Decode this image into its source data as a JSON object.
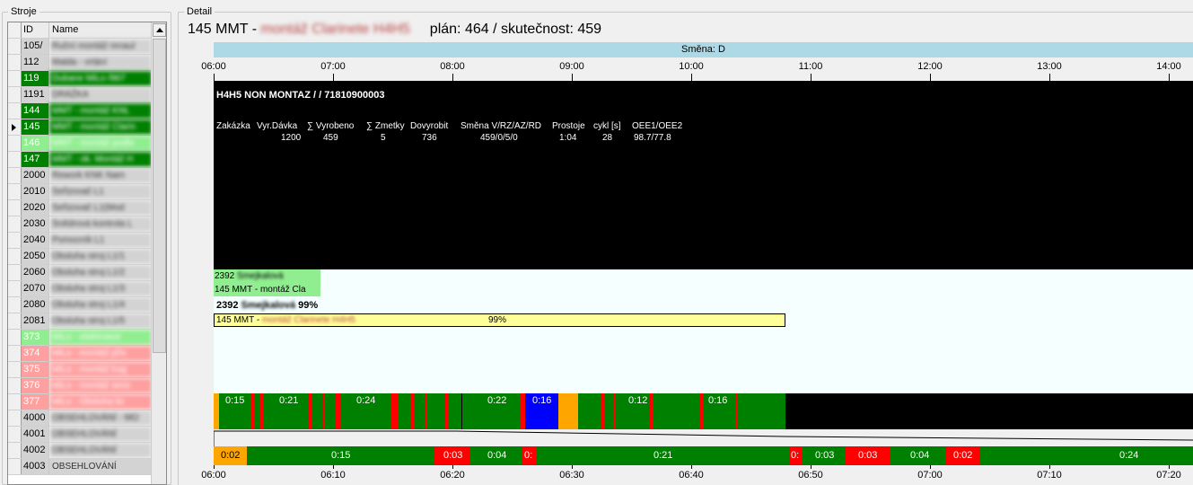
{
  "stroje": {
    "legend": "Stroje",
    "columns": {
      "id": "ID",
      "name": "Name"
    },
    "rows": [
      {
        "id": "105/",
        "name": "Ruční montáž renaul",
        "bg": "#d3d3d3",
        "blur": true
      },
      {
        "id": "112",
        "name": "Malda - vrtání",
        "bg": "#d3d3d3",
        "blur": true
      },
      {
        "id": "119",
        "name": "Dubane MiLo /967",
        "bg": "#008000",
        "fg": "#ffffff",
        "blur": true
      },
      {
        "id": "1191",
        "name": "DRÁŽKA",
        "bg": "#d3d3d3",
        "blur": true
      },
      {
        "id": "144",
        "name": "MMT - montáž KNL",
        "bg": "#008000",
        "fg": "#ffffff",
        "blur": true
      },
      {
        "id": "145",
        "name": "MMT - montáž Clarin",
        "bg": "#008000",
        "fg": "#ffffff",
        "blur": true,
        "selected": true
      },
      {
        "id": "146",
        "name": "MMT - montáž podlo",
        "bg": "#90ee90",
        "fg": "#ffffff",
        "blur": true
      },
      {
        "id": "147",
        "name": "MMT - ok. Montáž H",
        "bg": "#008000",
        "fg": "#ffffff",
        "blur": true
      },
      {
        "id": "2000",
        "name": "Rework KNK Nam",
        "bg": "#d3d3d3",
        "blur": true
      },
      {
        "id": "2010",
        "name": "Seřizovač L1",
        "bg": "#d3d3d3",
        "blur": true
      },
      {
        "id": "2020",
        "name": "Seřizovač L1(Mod",
        "bg": "#d3d3d3",
        "blur": true
      },
      {
        "id": "2030",
        "name": "Snědrová kontrola L",
        "bg": "#d3d3d3",
        "blur": true
      },
      {
        "id": "2040",
        "name": "Pomocník L1",
        "bg": "#d3d3d3",
        "blur": true
      },
      {
        "id": "2050",
        "name": "Obsluha stroj L1/1",
        "bg": "#d3d3d3",
        "blur": true
      },
      {
        "id": "2060",
        "name": "Obsluha stroj L1/2",
        "bg": "#d3d3d3",
        "blur": true
      },
      {
        "id": "2070",
        "name": "Obsluha stroj L1/3",
        "bg": "#d3d3d3",
        "blur": true
      },
      {
        "id": "2080",
        "name": "Obsluha stroj L1/4",
        "bg": "#d3d3d3",
        "blur": true
      },
      {
        "id": "2081",
        "name": "Obsluha stroj L1/5",
        "bg": "#d3d3d3",
        "blur": true
      },
      {
        "id": "373",
        "name": "MiLo - elektrotest",
        "bg": "#90ee90",
        "fg": "#ffffff",
        "blur": true
      },
      {
        "id": "374",
        "name": "MiLo - montáž přív",
        "bg": "#ffa0a0",
        "fg": "#ffffff",
        "blur": true
      },
      {
        "id": "375",
        "name": "MiLo - montáž hug",
        "bg": "#ffa0a0",
        "fg": "#ffffff",
        "blur": true
      },
      {
        "id": "376",
        "name": "MiLo - montáž senz",
        "bg": "#ffa0a0",
        "fg": "#ffffff",
        "blur": true
      },
      {
        "id": "377",
        "name": "MiLo - Obsluha lis",
        "bg": "#ffa0a0",
        "fg": "#ffffff",
        "blur": true
      },
      {
        "id": "4000",
        "name": "OBSEHLOVÁNÍ - MO",
        "bg": "#d3d3d3",
        "blur": true
      },
      {
        "id": "4001",
        "name": "OBSEHLOVÁNÍ",
        "bg": "#d3d3d3",
        "blur": true
      },
      {
        "id": "4002",
        "name": "OBSEHLOVÁNÍ",
        "bg": "#d3d3d3",
        "blur": true
      },
      {
        "id": "4003",
        "name": "OBSEHLOVÁNÍ",
        "bg": "#d3d3d3",
        "blur": false
      }
    ]
  },
  "detail": {
    "legend": "Detail",
    "title_prefix": "145 MMT - ",
    "title_blurred": "montáž Clarinete H4H5",
    "plan_text": "plán: 464 / skutečnost: 459",
    "shift_label": "Směna: D",
    "top_times": [
      "06:00",
      "07:00",
      "08:00",
      "09:00",
      "10:00",
      "11:00",
      "12:00",
      "13:00",
      "14:00"
    ],
    "order": {
      "title": "H4H5 NON MONTAZ / / 71810900003",
      "headers": [
        "Zakázka",
        "Vyr.Dávka",
        "∑ Vyrobeno",
        "∑ Zmetky",
        "Dovyrobit",
        "Směna V/RZ/AZ/RD",
        "Prostoje",
        "cykl [s]",
        "OEE1/OEE2"
      ],
      "values": [
        "",
        "1200",
        "459",
        "5",
        "736",
        "459/0/5/0",
        "1:04",
        "28",
        "98.7/77.8"
      ]
    },
    "operator_box": {
      "line1_id": "2392",
      "line1_name": "Smejkalová",
      "line2": "145 MMT - montáž Cla"
    },
    "operator_line": {
      "id": "2392",
      "name": "Smejkalová",
      "pct": "99%"
    },
    "progress": {
      "prefix": "145 MMT - ",
      "blurred": "montáž Clarinete H4H5",
      "label": "99%",
      "fraction": 0.99
    },
    "status_labels": [
      "0:15",
      "0:21",
      "0:24",
      "0:22",
      "0:16",
      "0:12",
      "0:16"
    ],
    "bottom_labels": [
      "0:02",
      "0:15",
      "0:03",
      "0:04",
      "0:",
      "0:21",
      "0:",
      "0:03",
      "0:03",
      "0:04",
      "0:02",
      "0:24"
    ],
    "bottom_times": [
      "06:00",
      "06:10",
      "06:20",
      "06:30",
      "06:40",
      "06:50",
      "07:00",
      "07:10",
      "07:20"
    ],
    "colors": {
      "run": "#008000",
      "stop": "#ff0000",
      "setup": "#ffa500",
      "blue": "#0000ff",
      "none": "#000000"
    }
  }
}
